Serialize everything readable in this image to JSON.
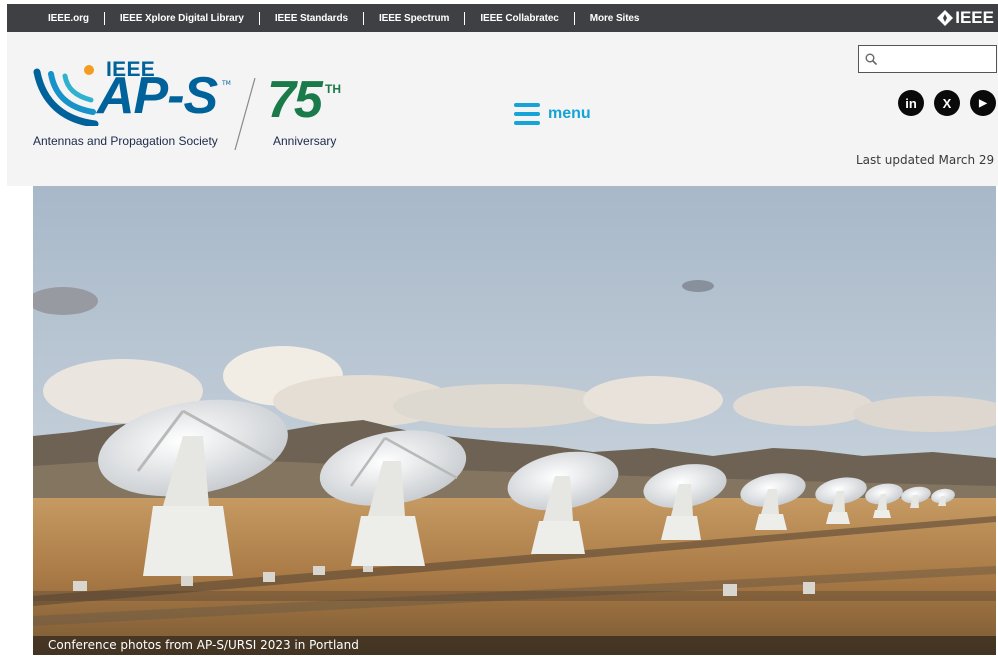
{
  "topbar": {
    "links": [
      {
        "label": "IEEE.org"
      },
      {
        "label": "IEEE Xplore Digital Library"
      },
      {
        "label": "IEEE Standards"
      },
      {
        "label": "IEEE Spectrum"
      },
      {
        "label": "IEEE Collabratec"
      },
      {
        "label": "More Sites"
      }
    ],
    "brand": "IEEE"
  },
  "logo": {
    "org": "IEEE",
    "name": "AP-S",
    "tm": "TM",
    "society": "Antennas and Propagation Society",
    "number": "75",
    "suffix": "TH",
    "anniversary": "Anniversary"
  },
  "menu": {
    "label": "menu"
  },
  "search": {
    "placeholder": "",
    "value": ""
  },
  "social": [
    {
      "icon": "linkedin-icon",
      "glyph": "in"
    },
    {
      "icon": "x-icon",
      "glyph": "X"
    },
    {
      "icon": "youtube-icon",
      "glyph": "▶"
    }
  ],
  "status": {
    "last_updated": "Last updated March 29"
  },
  "hero": {
    "caption": "Conference photos from AP-S/URSI 2023 in Portland"
  },
  "colors": {
    "topbar_bg": "#3f4044",
    "brand_blue": "#00629b",
    "anniversary_green": "#1b7a4a",
    "menu_blue": "#15a3d8",
    "header_bg": "#f4f4f4"
  }
}
